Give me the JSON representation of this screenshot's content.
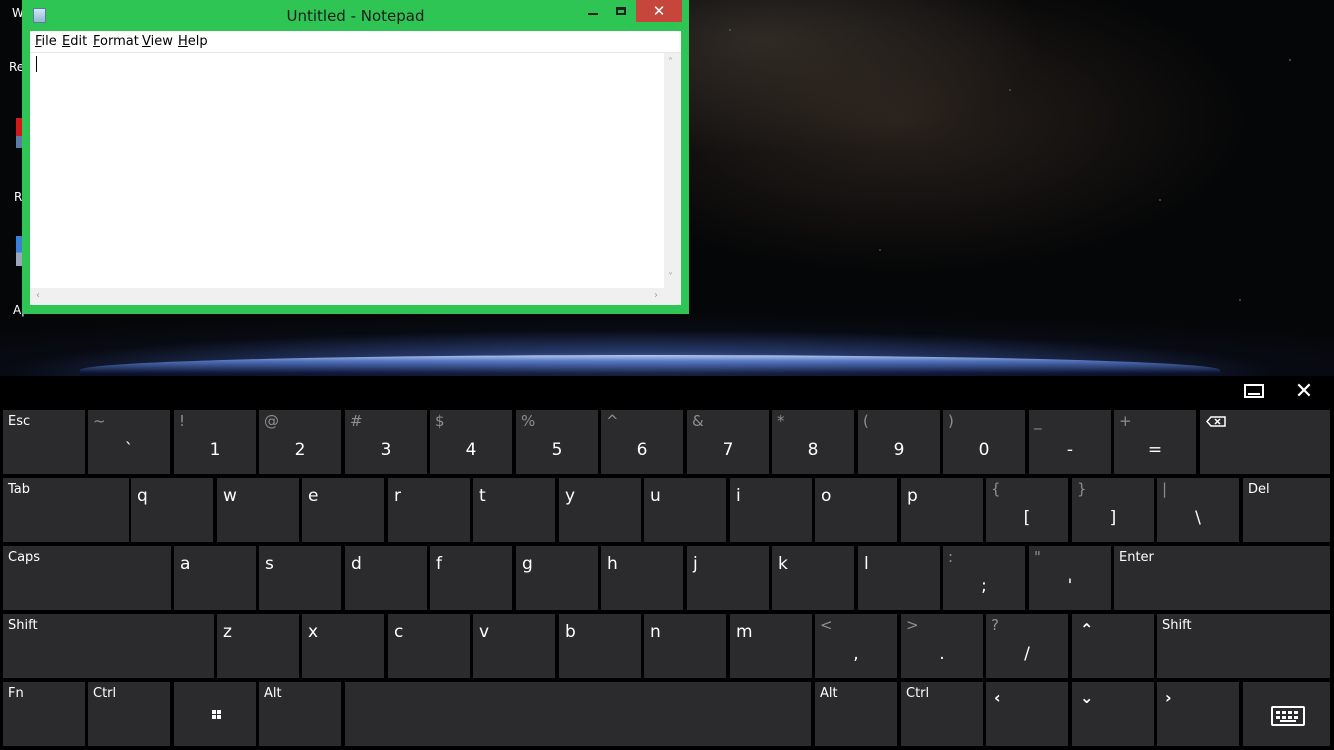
{
  "desktop": {
    "icon_labels": [
      "W",
      "Re",
      "R",
      "Ap"
    ]
  },
  "notepad": {
    "title": "Untitled - Notepad",
    "close_glyph": "✕",
    "menu": [
      {
        "accel": "F",
        "rest": "ile"
      },
      {
        "accel": "E",
        "rest": "dit"
      },
      {
        "accel": "F",
        "rest": "ormat",
        "accel_pos": "first"
      },
      {
        "accel": "V",
        "rest": "iew"
      },
      {
        "accel": "H",
        "rest": "elp"
      }
    ],
    "content": ""
  },
  "keyboard": {
    "close_glyph": "✕",
    "rows": [
      [
        {
          "label": "Esc"
        },
        {
          "shift": "~",
          "main": "`"
        },
        {
          "shift": "!",
          "main": "1"
        },
        {
          "shift": "@",
          "main": "2"
        },
        {
          "shift": "#",
          "main": "3"
        },
        {
          "shift": "$",
          "main": "4"
        },
        {
          "shift": "%",
          "main": "5"
        },
        {
          "shift": "^",
          "main": "6"
        },
        {
          "shift": "&",
          "main": "7"
        },
        {
          "shift": "*",
          "main": "8"
        },
        {
          "shift": "(",
          "main": "9"
        },
        {
          "shift": ")",
          "main": "0"
        },
        {
          "shift": "_",
          "main": "-"
        },
        {
          "shift": "+",
          "main": "="
        },
        {
          "icon": "backspace-icon"
        }
      ],
      [
        {
          "label": "Tab"
        },
        {
          "letter": "q"
        },
        {
          "letter": "w"
        },
        {
          "letter": "e"
        },
        {
          "letter": "r"
        },
        {
          "letter": "t"
        },
        {
          "letter": "y"
        },
        {
          "letter": "u"
        },
        {
          "letter": "i"
        },
        {
          "letter": "o"
        },
        {
          "letter": "p"
        },
        {
          "shift": "{",
          "main": "["
        },
        {
          "shift": "}",
          "main": "]"
        },
        {
          "shift": "|",
          "main": "\\"
        },
        {
          "label": "Del"
        }
      ],
      [
        {
          "label": "Caps"
        },
        {
          "letter": "a"
        },
        {
          "letter": "s"
        },
        {
          "letter": "d"
        },
        {
          "letter": "f"
        },
        {
          "letter": "g"
        },
        {
          "letter": "h"
        },
        {
          "letter": "j"
        },
        {
          "letter": "k"
        },
        {
          "letter": "l"
        },
        {
          "shift": ":",
          "main": ";"
        },
        {
          "shift": "\"",
          "main": "'"
        },
        {
          "label": "Enter"
        }
      ],
      [
        {
          "label": "Shift"
        },
        {
          "letter": "z"
        },
        {
          "letter": "x"
        },
        {
          "letter": "c"
        },
        {
          "letter": "v"
        },
        {
          "letter": "b"
        },
        {
          "letter": "n"
        },
        {
          "letter": "m"
        },
        {
          "shift": "<",
          "main": ","
        },
        {
          "shift": ">",
          "main": "."
        },
        {
          "shift": "?",
          "main": "/"
        },
        {
          "glyph": "⌃"
        },
        {
          "label": "Shift"
        }
      ],
      [
        {
          "label": "Fn"
        },
        {
          "label": "Ctrl"
        },
        {
          "icon": "windows-icon"
        },
        {
          "label": "Alt"
        },
        {
          "space": true
        },
        {
          "label": "Alt"
        },
        {
          "label": "Ctrl"
        },
        {
          "glyph": "‹"
        },
        {
          "glyph": "⌄"
        },
        {
          "glyph": "›"
        },
        {
          "icon": "keyboard-icon"
        }
      ]
    ]
  }
}
